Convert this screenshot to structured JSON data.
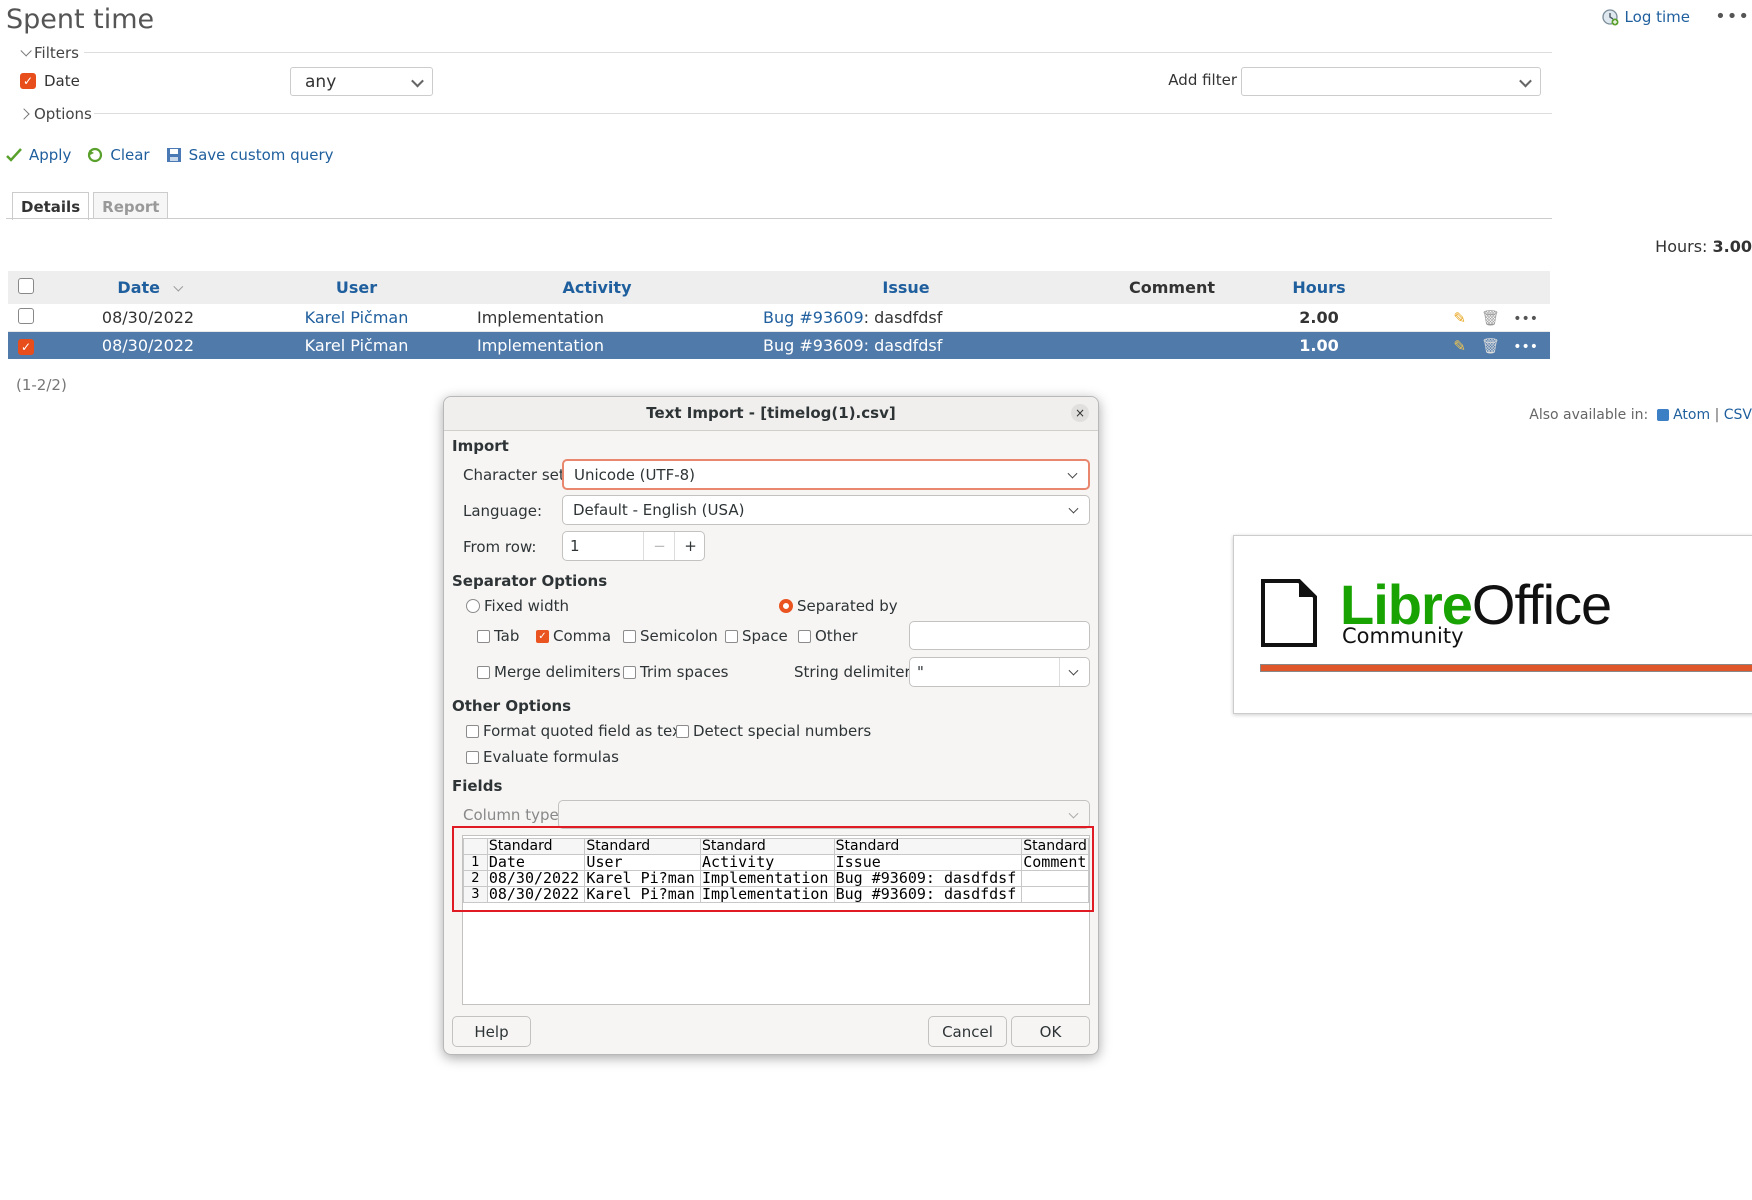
{
  "page": {
    "title": "Spent time",
    "log_time": "Log time",
    "more": "•••"
  },
  "filters": {
    "legend": "Filters",
    "date_label": "Date",
    "date_operator": "any",
    "add_filter_label": "Add filter",
    "add_filter_value": "",
    "options_legend": "Options"
  },
  "actions": {
    "apply": "Apply",
    "clear": "Clear",
    "save": "Save custom query"
  },
  "tabs": [
    {
      "label": "Details",
      "active": true
    },
    {
      "label": "Report",
      "active": false
    }
  ],
  "totals": {
    "label": "Hours:",
    "value": "3.00"
  },
  "table": {
    "columns": [
      "Date",
      "User",
      "Activity",
      "Issue",
      "Comment",
      "Hours"
    ],
    "rows": [
      {
        "date": "08/30/2022",
        "user": "Karel Pičman",
        "activity": "Implementation",
        "issue_link": "Bug #93609",
        "issue_text": ": dasdfdsf",
        "comment": "",
        "hours": "2.00",
        "selected": false
      },
      {
        "date": "08/30/2022",
        "user": "Karel Pičman",
        "activity": "Implementation",
        "issue_link": "Bug #93609",
        "issue_text": ": dasdfdsf",
        "comment": "",
        "hours": "1.00",
        "selected": true
      }
    ]
  },
  "pager": "(1-2/2)",
  "also_available": {
    "label": "Also available in:",
    "atom": "Atom",
    "sep": "|",
    "csv": "CSV"
  },
  "dialog": {
    "title": "Text Import - [timelog(1).csv]",
    "close": "×",
    "import_section": "Import",
    "charset_label": "Character set:",
    "charset_value": "Unicode (UTF-8)",
    "language_label": "Language:",
    "language_value": "Default - English (USA)",
    "from_row_label": "From row:",
    "from_row_value": "1",
    "minus": "−",
    "plus": "+",
    "separator_section": "Separator Options",
    "fixed_width": "Fixed width",
    "separated_by": "Separated by",
    "tab": "Tab",
    "comma": "Comma",
    "semicolon": "Semicolon",
    "space": "Space",
    "other": "Other",
    "other_value": "",
    "merge_delimiters": "Merge delimiters",
    "trim_spaces": "Trim spaces",
    "string_delimiter_label": "String delimiter:",
    "string_delimiter_value": "\"",
    "other_section": "Other Options",
    "format_quoted": "Format quoted field as text",
    "detect_special": "Detect special numbers",
    "evaluate_formulas": "Evaluate formulas",
    "fields_section": "Fields",
    "column_type_label": "Column type:",
    "column_type_value": "",
    "preview": {
      "header": [
        "Standard",
        "Standard",
        "Standard",
        "Standard",
        "Standard"
      ],
      "rows": [
        {
          "n": "1",
          "cells": [
            "Date",
            "User",
            "Activity",
            "Issue",
            "Comment"
          ]
        },
        {
          "n": "2",
          "cells": [
            "08/30/2022",
            "Karel Pi?man",
            "Implementation",
            "Bug #93609: dasdfdsf",
            ""
          ]
        },
        {
          "n": "3",
          "cells": [
            "08/30/2022",
            "Karel Pi?man",
            "Implementation",
            "Bug #93609: dasdfdsf",
            ""
          ]
        }
      ]
    },
    "help": "Help",
    "cancel": "Cancel",
    "ok": "OK"
  },
  "splash": {
    "brand_libre": "Libre",
    "brand_office": "Office",
    "community": "Community"
  }
}
